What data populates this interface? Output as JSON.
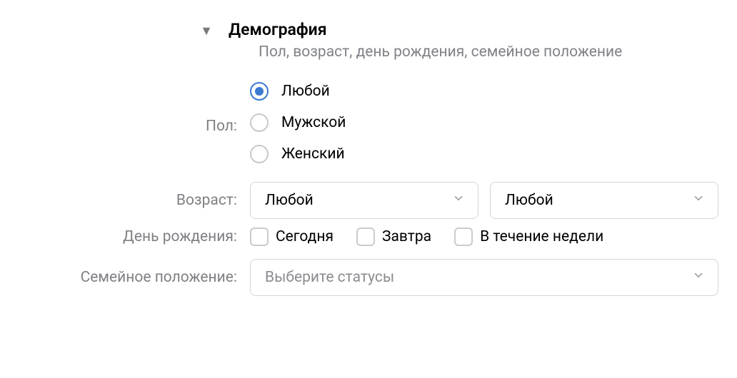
{
  "section": {
    "title": "Демография",
    "subtitle": "Пол, возраст, день рождения, семейное положение"
  },
  "gender": {
    "label": "Пол:",
    "options": {
      "any": "Любой",
      "male": "Мужской",
      "female": "Женский"
    },
    "selected": "any"
  },
  "age": {
    "label": "Возраст:",
    "from": "Любой",
    "to": "Любой"
  },
  "birthday": {
    "label": "День рождения:",
    "options": {
      "today": "Сегодня",
      "tomorrow": "Завтра",
      "week": "В течение недели"
    }
  },
  "marital": {
    "label": "Семейное положение:",
    "placeholder": "Выберите статусы"
  }
}
